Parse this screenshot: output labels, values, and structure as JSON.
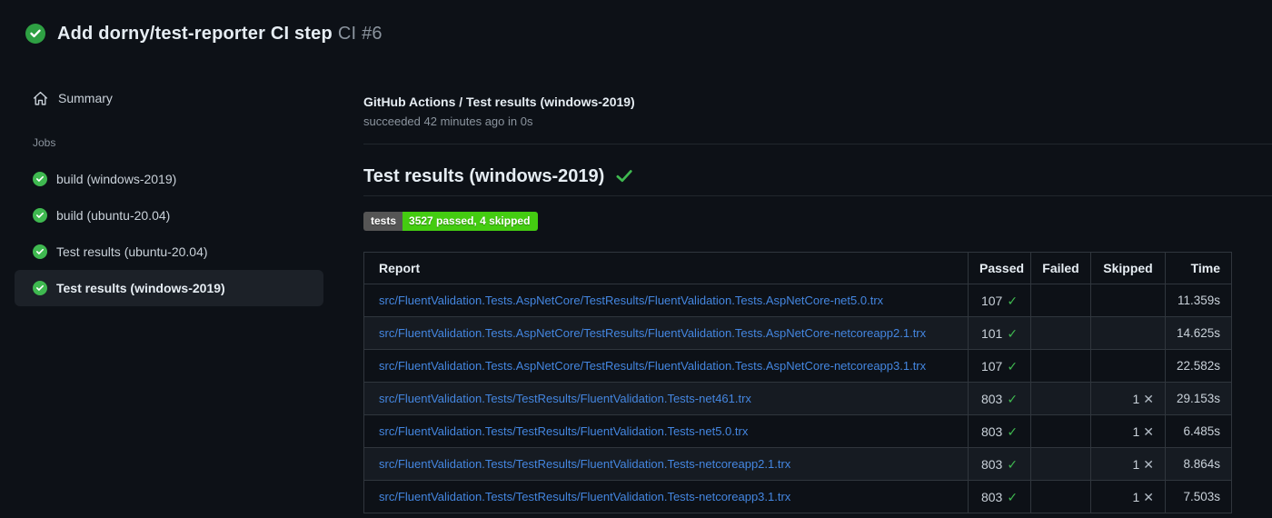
{
  "colors": {
    "background": "#0d1117",
    "row_alt_background": "#161b22",
    "table_border": "#30363d",
    "divider": "#21262d",
    "link_blue": "#4486e0",
    "success_green": "#3fb950",
    "muted_text": "#8b949e",
    "badge_label_bg": "#555555",
    "badge_value_bg": "#44cc11",
    "selected_item_bg": "#1c2128"
  },
  "icons": {
    "status": "check-circle-icon",
    "home": "home-icon",
    "check": "✓",
    "cross": "✕"
  },
  "header": {
    "title": "Add dorny/test-reporter CI step",
    "run_number": "CI #6"
  },
  "sidebar": {
    "summary_label": "Summary",
    "jobs_label": "Jobs",
    "jobs": [
      {
        "label": "build (windows-2019)",
        "selected": false
      },
      {
        "label": "build (ubuntu-20.04)",
        "selected": false
      },
      {
        "label": "Test results (ubuntu-20.04)",
        "selected": false
      },
      {
        "label": "Test results (windows-2019)",
        "selected": true
      }
    ]
  },
  "main": {
    "run_title": "GitHub Actions / Test results (windows-2019)",
    "run_status": "succeeded 42 minutes ago in 0s",
    "heading": "Test results (windows-2019)",
    "badge": {
      "label": "tests",
      "value": "3527 passed, 4 skipped"
    },
    "table": {
      "headers": [
        "Report",
        "Passed",
        "Failed",
        "Skipped",
        "Time"
      ],
      "rows": [
        {
          "report": "src/FluentValidation.Tests.AspNetCore/TestResults/FluentValidation.Tests.AspNetCore-net5.0.trx",
          "passed": "107",
          "failed": "",
          "skipped": "",
          "time": "11.359s"
        },
        {
          "report": "src/FluentValidation.Tests.AspNetCore/TestResults/FluentValidation.Tests.AspNetCore-netcoreapp2.1.trx",
          "passed": "101",
          "failed": "",
          "skipped": "",
          "time": "14.625s"
        },
        {
          "report": "src/FluentValidation.Tests.AspNetCore/TestResults/FluentValidation.Tests.AspNetCore-netcoreapp3.1.trx",
          "passed": "107",
          "failed": "",
          "skipped": "",
          "time": "22.582s"
        },
        {
          "report": "src/FluentValidation.Tests/TestResults/FluentValidation.Tests-net461.trx",
          "passed": "803",
          "failed": "",
          "skipped": "1",
          "time": "29.153s"
        },
        {
          "report": "src/FluentValidation.Tests/TestResults/FluentValidation.Tests-net5.0.trx",
          "passed": "803",
          "failed": "",
          "skipped": "1",
          "time": "6.485s"
        },
        {
          "report": "src/FluentValidation.Tests/TestResults/FluentValidation.Tests-netcoreapp2.1.trx",
          "passed": "803",
          "failed": "",
          "skipped": "1",
          "time": "8.864s"
        },
        {
          "report": "src/FluentValidation.Tests/TestResults/FluentValidation.Tests-netcoreapp3.1.trx",
          "passed": "803",
          "failed": "",
          "skipped": "1",
          "time": "7.503s"
        }
      ]
    }
  }
}
